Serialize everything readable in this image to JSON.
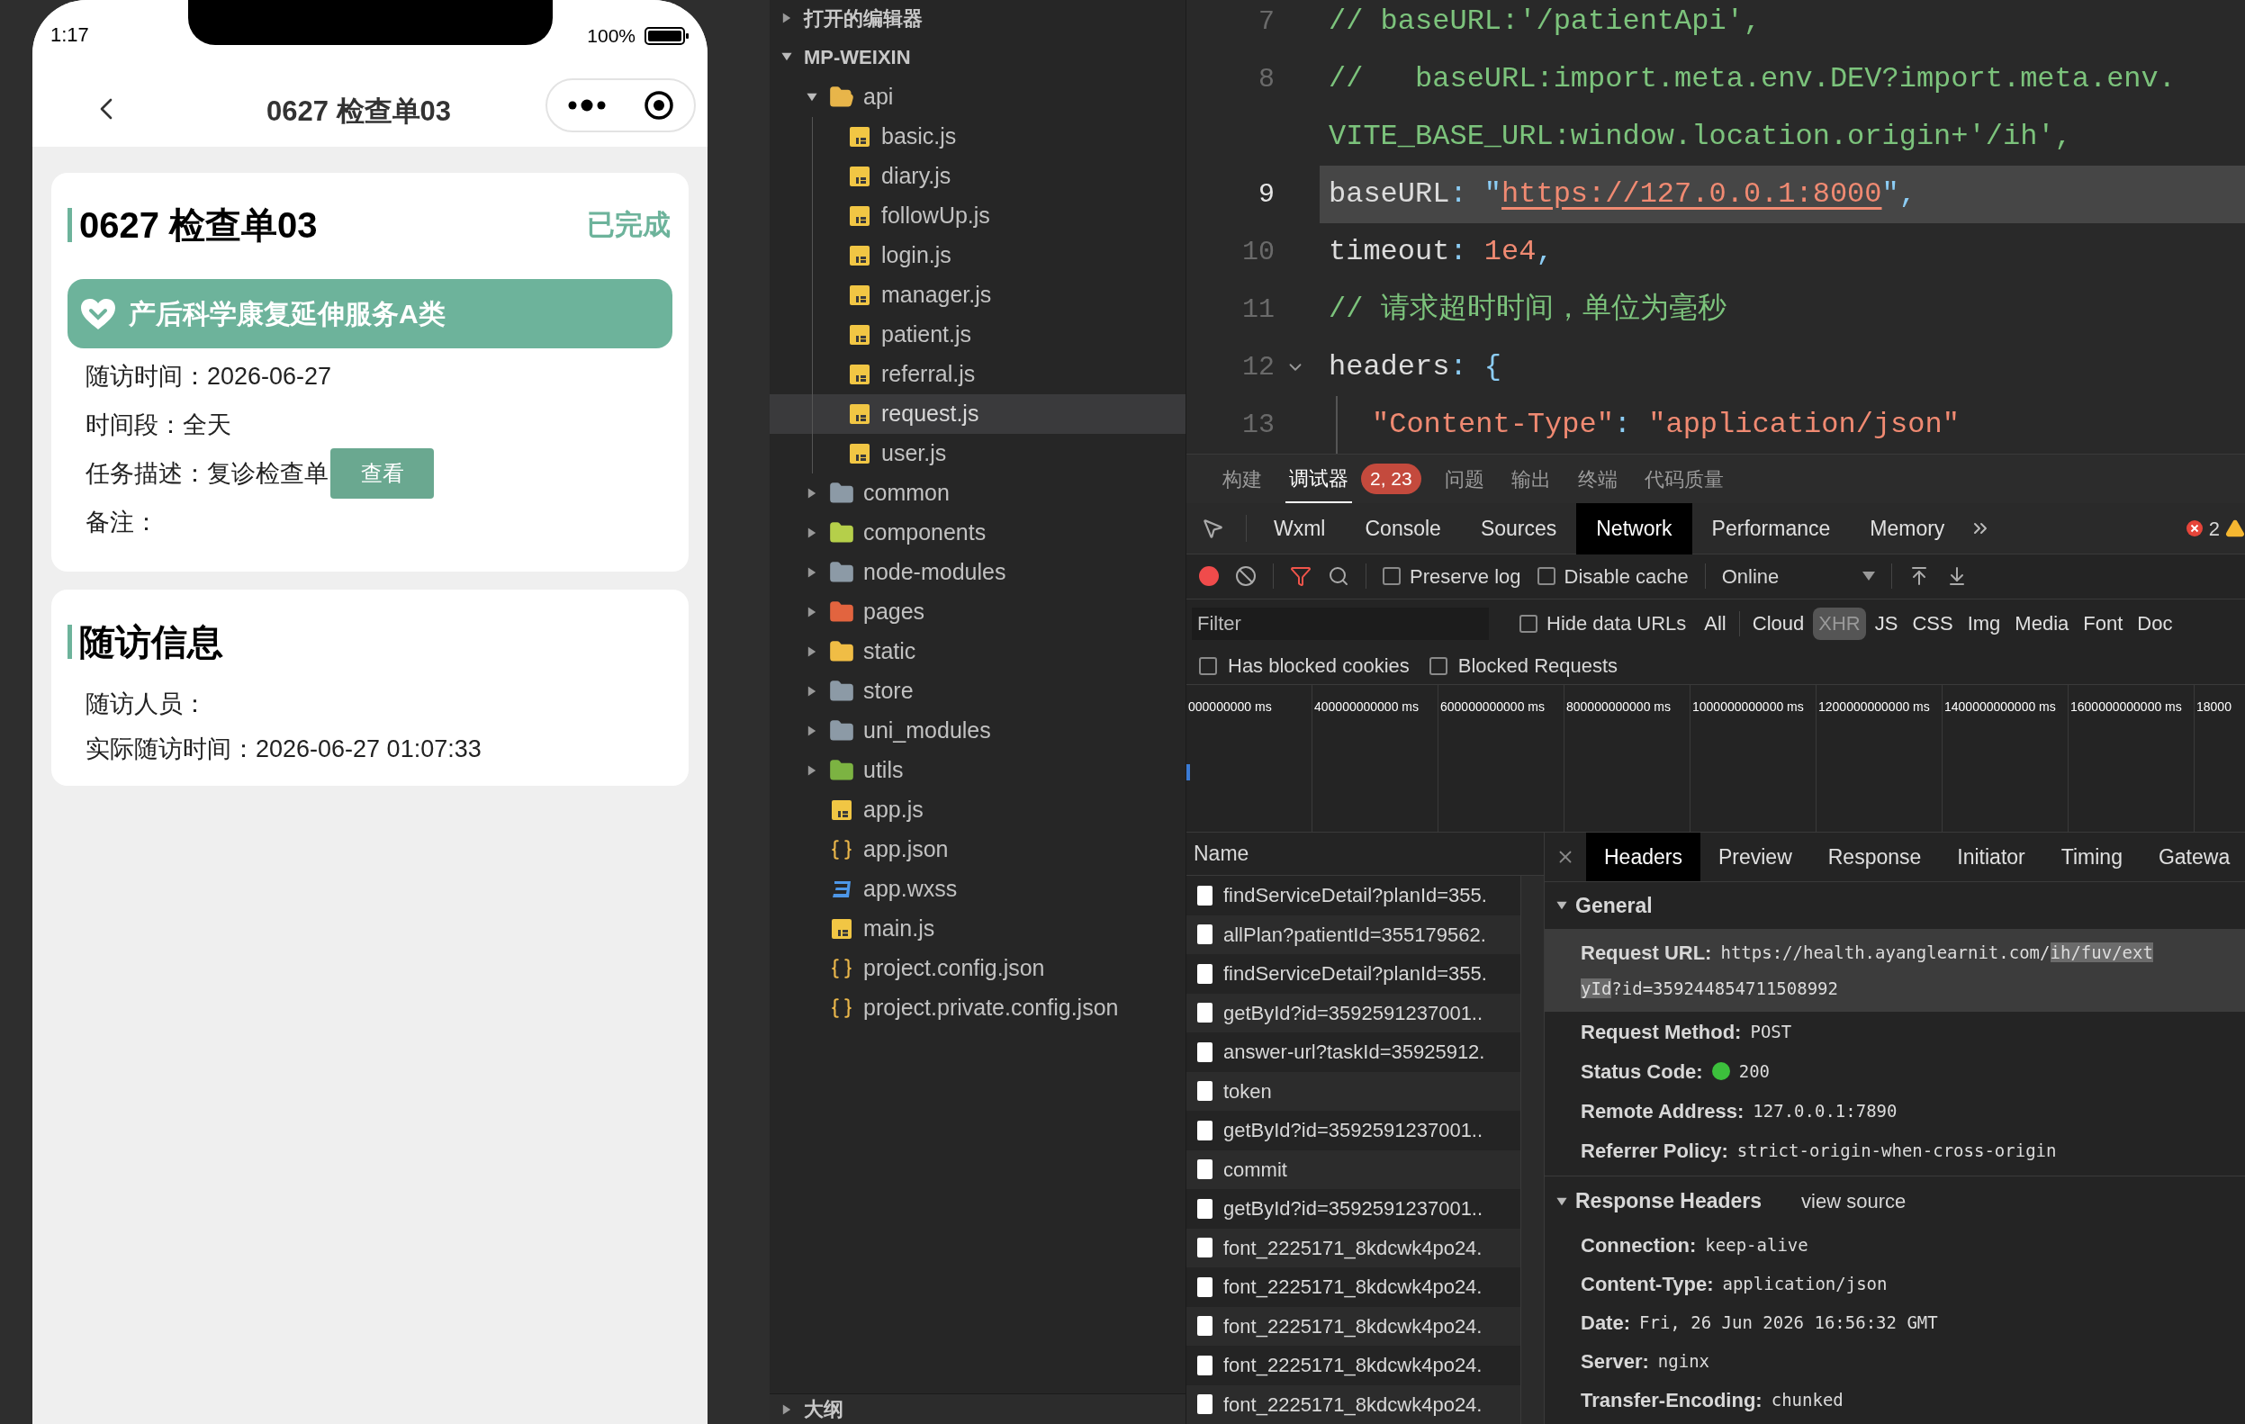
{
  "phone": {
    "status_bar": {
      "time": "1:17",
      "battery": "100%"
    },
    "nav": {
      "title": "0627 检查单03"
    },
    "task_card": {
      "title": "0627 检查单03",
      "status": "已完成",
      "service": "产后科学康复延伸服务A类",
      "fields": [
        {
          "label": "随访时间：",
          "value": "2026-06-27"
        },
        {
          "label": "时间段：",
          "value": "全天"
        },
        {
          "label": "任务描述：",
          "value": "复诊检查单",
          "button": "查看"
        },
        {
          "label": "备注："
        }
      ]
    },
    "visit_card": {
      "title": "随访信息",
      "fields": [
        {
          "label": "随访人员："
        },
        {
          "label": "实际随访时间：",
          "value": "2026-06-27 01:07:33"
        }
      ]
    }
  },
  "explorer": {
    "open_editors": {
      "label": "打开的编辑器",
      "expanded": false
    },
    "project": {
      "label": "MP-WEIXIN",
      "expanded": true
    },
    "tree": [
      {
        "name": "api",
        "kind": "folder",
        "color": "#e8b54a",
        "expanded": true,
        "selected": false,
        "children": [
          {
            "name": "basic.js",
            "kind": "js",
            "selected": false
          },
          {
            "name": "diary.js",
            "kind": "js",
            "selected": false
          },
          {
            "name": "followUp.js",
            "kind": "js",
            "selected": false
          },
          {
            "name": "login.js",
            "kind": "js",
            "selected": false
          },
          {
            "name": "manager.js",
            "kind": "js",
            "selected": false
          },
          {
            "name": "patient.js",
            "kind": "js",
            "selected": false
          },
          {
            "name": "referral.js",
            "kind": "js",
            "selected": false
          },
          {
            "name": "request.js",
            "kind": "js",
            "selected": true
          },
          {
            "name": "user.js",
            "kind": "js",
            "selected": false
          }
        ]
      },
      {
        "name": "common",
        "kind": "folder",
        "color": "#8c9aa6",
        "expanded": false,
        "selected": false
      },
      {
        "name": "components",
        "kind": "folder",
        "color": "#b5cf4a",
        "expanded": false,
        "selected": false
      },
      {
        "name": "node-modules",
        "kind": "folder",
        "color": "#8c9aa6",
        "expanded": false,
        "selected": false
      },
      {
        "name": "pages",
        "kind": "folder",
        "color": "#e2643f",
        "expanded": false,
        "selected": false
      },
      {
        "name": "static",
        "kind": "folder",
        "color": "#f0bd45",
        "expanded": false,
        "selected": false
      },
      {
        "name": "store",
        "kind": "folder",
        "color": "#8c9aa6",
        "expanded": false,
        "selected": false
      },
      {
        "name": "uni_modules",
        "kind": "folder",
        "color": "#8c9aa6",
        "expanded": false,
        "selected": false
      },
      {
        "name": "utils",
        "kind": "folder",
        "color": "#7cb342",
        "expanded": false,
        "selected": false
      },
      {
        "name": "app.js",
        "kind": "js",
        "selected": false
      },
      {
        "name": "app.json",
        "kind": "json",
        "selected": false
      },
      {
        "name": "app.wxss",
        "kind": "css",
        "selected": false
      },
      {
        "name": "main.js",
        "kind": "js",
        "selected": false
      },
      {
        "name": "project.config.json",
        "kind": "json",
        "selected": false
      },
      {
        "name": "project.private.config.json",
        "kind": "json",
        "selected": false
      }
    ],
    "outline": {
      "label": "大纲",
      "expanded": false
    }
  },
  "editor": {
    "lines": [
      {
        "number": "7",
        "current": false,
        "foldable": false,
        "indented": false,
        "tokens": [
          {
            "kind": "comment",
            "text": "// baseURL:'/patientApi',"
          }
        ]
      },
      {
        "number": "8",
        "current": false,
        "foldable": false,
        "indented": false,
        "tokens": [
          {
            "kind": "comment",
            "text": "//   baseURL:import.meta.env.DEV?import.meta.env."
          }
        ]
      },
      {
        "current": false,
        "foldable": false,
        "indented": false,
        "tokens": [
          {
            "kind": "comment",
            "text": "VITE_BASE_URL:window.location.origin+'/ih',"
          }
        ]
      },
      {
        "number": "9",
        "current": true,
        "foldable": false,
        "indented": false,
        "tokens": [
          {
            "kind": "key",
            "text": "baseURL"
          },
          {
            "kind": "punct",
            "text": ": \""
          },
          {
            "kind": "url",
            "text": "https://127.0.0.1:8000"
          },
          {
            "kind": "punct",
            "text": "\","
          }
        ]
      },
      {
        "number": "10",
        "current": false,
        "foldable": false,
        "indented": false,
        "tokens": [
          {
            "kind": "key",
            "text": "timeout"
          },
          {
            "kind": "punct",
            "text": ": "
          },
          {
            "kind": "number",
            "text": "1e4"
          },
          {
            "kind": "punct",
            "text": ","
          }
        ]
      },
      {
        "number": "11",
        "current": false,
        "foldable": false,
        "indented": false,
        "tokens": [
          {
            "kind": "comment",
            "text": "// 请求超时时间，单位为毫秒"
          }
        ]
      },
      {
        "number": "12",
        "current": false,
        "foldable": true,
        "indented": false,
        "tokens": [
          {
            "kind": "key",
            "text": "headers"
          },
          {
            "kind": "punct",
            "text": ": {"
          }
        ]
      },
      {
        "number": "13",
        "current": false,
        "foldable": false,
        "indented": true,
        "tokens": [
          {
            "kind": "string",
            "text": "\"Content-Type\""
          },
          {
            "kind": "punct",
            "text": ": "
          },
          {
            "kind": "string",
            "text": "\"application/json\""
          }
        ]
      }
    ]
  },
  "devtools": {
    "panel_tabs": [
      {
        "label": "构建",
        "selected": false
      },
      {
        "label": "调试器",
        "selected": true,
        "badge": "2, 23"
      },
      {
        "label": "问题",
        "selected": false
      },
      {
        "label": "输出",
        "selected": false
      },
      {
        "label": "终端",
        "selected": false
      },
      {
        "label": "代码质量",
        "selected": false
      }
    ],
    "tools": [
      {
        "label": "Wxml",
        "selected": false
      },
      {
        "label": "Console",
        "selected": false
      },
      {
        "label": "Sources",
        "selected": false
      },
      {
        "label": "Network",
        "selected": true
      },
      {
        "label": "Performance",
        "selected": false
      },
      {
        "label": "Memory",
        "selected": false
      }
    ],
    "error_count": "2",
    "toolbar": {
      "recording": true,
      "options": [
        {
          "label": "Preserve log",
          "checked": false
        },
        {
          "label": "Disable cache",
          "checked": false
        }
      ],
      "throttle": "Online"
    },
    "filter": {
      "placeholder": "Filter",
      "hide_data_urls": {
        "label": "Hide data URLs",
        "checked": false
      },
      "types": [
        {
          "label": "All",
          "selected": false
        },
        {
          "label": "Cloud",
          "selected": false
        },
        {
          "label": "XHR",
          "selected": true
        },
        {
          "label": "JS",
          "selected": false
        },
        {
          "label": "CSS",
          "selected": false
        },
        {
          "label": "Img",
          "selected": false
        },
        {
          "label": "Media",
          "selected": false
        },
        {
          "label": "Font",
          "selected": false
        },
        {
          "label": "Doc",
          "selected": false
        }
      ]
    },
    "blocked": [
      {
        "label": "Has blocked cookies",
        "checked": false
      },
      {
        "label": "Blocked Requests",
        "checked": false
      }
    ],
    "timeline": {
      "ticks": [
        "000000000 ms",
        "400000000000 ms",
        "600000000000 ms",
        "800000000000 ms",
        "1000000000000 ms",
        "1200000000000 ms",
        "1400000000000 ms",
        "1600000000000 ms",
        "18000"
      ]
    },
    "requests": {
      "column": "Name",
      "rows": [
        {
          "name": "findServiceDetail?planId=355."
        },
        {
          "name": "allPlan?patientId=355179562."
        },
        {
          "name": "findServiceDetail?planId=355."
        },
        {
          "name": "getById?id=3592591237001.."
        },
        {
          "name": "answer-url?taskId=35925912."
        },
        {
          "name": "token"
        },
        {
          "name": "getById?id=3592591237001.."
        },
        {
          "name": "commit"
        },
        {
          "name": "getById?id=3592591237001.."
        },
        {
          "name": "font_2225171_8kdcwk4po24."
        },
        {
          "name": "font_2225171_8kdcwk4po24."
        },
        {
          "name": "font_2225171_8kdcwk4po24."
        },
        {
          "name": "font_2225171_8kdcwk4po24."
        },
        {
          "name": "font_2225171_8kdcwk4po24."
        }
      ]
    },
    "details": {
      "tabs": [
        {
          "label": "Headers",
          "selected": true
        },
        {
          "label": "Preview",
          "selected": false
        },
        {
          "label": "Response",
          "selected": false
        },
        {
          "label": "Initiator",
          "selected": false
        },
        {
          "label": "Timing",
          "selected": false
        },
        {
          "label": "Gatewa",
          "selected": false
        }
      ],
      "general": {
        "title": "General",
        "expanded": true,
        "rows": [
          {
            "label": "Request URL:",
            "selected": true,
            "lines": [
              [
                {
                  "text": "https://health.ayanglearnit.com/",
                  "selected": false
                },
                {
                  "text": "ih/fuv/ext",
                  "selected": true
                }
              ],
              [
                {
                  "text": "yId",
                  "selected": true
                },
                {
                  "text": "?id=359244854711508992",
                  "selected": false
                }
              ]
            ]
          },
          {
            "label": "Request Method:",
            "selected": false,
            "value": "POST"
          },
          {
            "label": "Status Code:",
            "selected": false,
            "value": "200",
            "color": "#3cc03c"
          },
          {
            "label": "Remote Address:",
            "selected": false,
            "value": "127.0.0.1:7890"
          },
          {
            "label": "Referrer Policy:",
            "selected": false,
            "value": "strict-origin-when-cross-origin"
          }
        ]
      },
      "response_headers": {
        "title": "Response Headers",
        "expanded": true,
        "link": "view source",
        "rows": [
          {
            "label": "Connection:",
            "value": "keep-alive"
          },
          {
            "label": "Content-Type:",
            "value": "application/json"
          },
          {
            "label": "Date:",
            "value": "Fri, 26 Jun 2026 16:56:32 GMT"
          },
          {
            "label": "Server:",
            "value": "nginx"
          },
          {
            "label": "Transfer-Encoding:",
            "value": "chunked"
          }
        ]
      }
    }
  }
}
